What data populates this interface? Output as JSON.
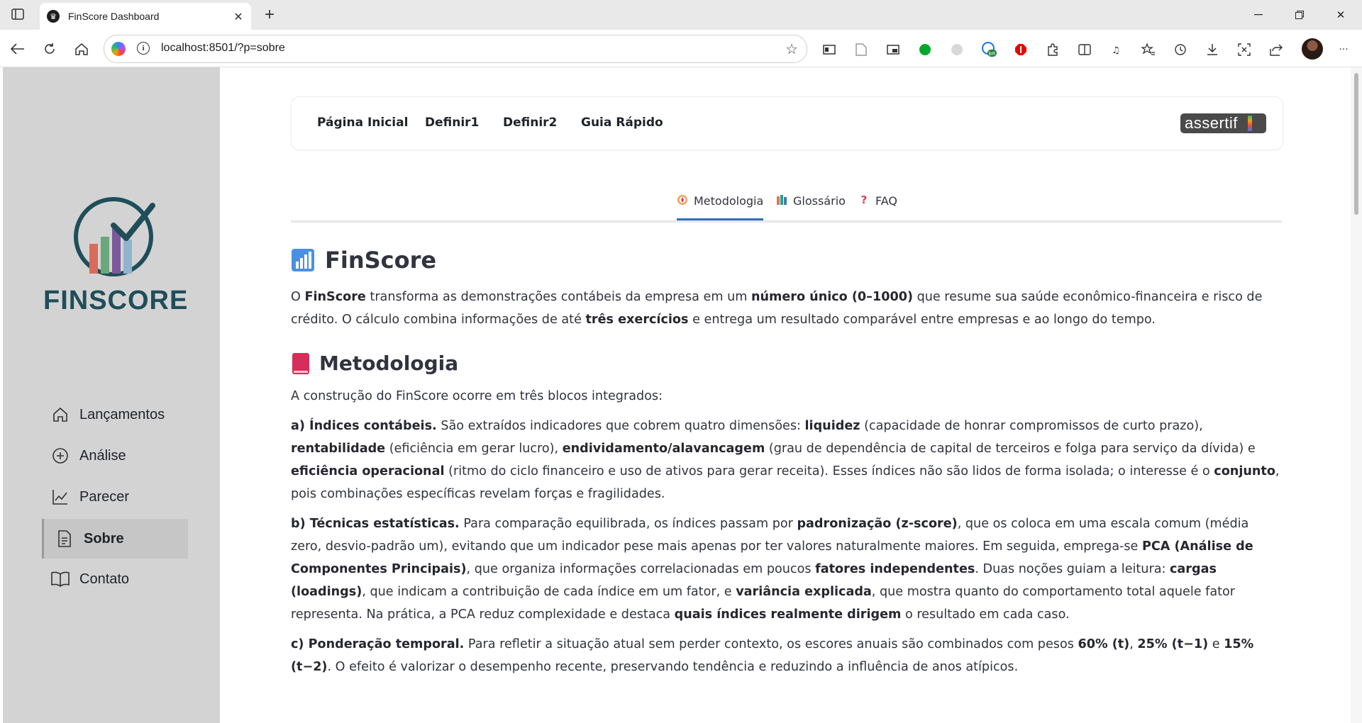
{
  "browser": {
    "tab_title": "FinScore Dashboard",
    "url": "localhost:8501/?p=sobre",
    "ext_badge": "BR"
  },
  "sidebar": {
    "logo_text": "FINSCORE",
    "items": [
      {
        "label": "Lançamentos",
        "icon": "house-icon"
      },
      {
        "label": "Análise",
        "icon": "plus-circle-icon"
      },
      {
        "label": "Parecer",
        "icon": "chart-line-icon"
      },
      {
        "label": "Sobre",
        "icon": "document-icon",
        "active": true
      },
      {
        "label": "Contato",
        "icon": "book-icon"
      }
    ]
  },
  "topnav": {
    "links": [
      "Página Inicial",
      "Definir1",
      "Definir2",
      "Guia Rápido"
    ],
    "brand": "assertif"
  },
  "tabs": [
    {
      "label": "Metodologia",
      "icon": "compass-icon",
      "active": true
    },
    {
      "label": "Glossário",
      "icon": "books-icon"
    },
    {
      "label": "FAQ",
      "icon": "question-icon"
    }
  ],
  "content": {
    "title": "FinScore",
    "intro": [
      {
        "t": "O "
      },
      {
        "b": "FinScore"
      },
      {
        "t": " transforma as demonstrações contábeis da empresa em um "
      },
      {
        "b": "número único (0–1000)"
      },
      {
        "t": " que resume sua saúde econômico-financeira e risco de crédito. O cálculo combina informações de até "
      },
      {
        "b": "três exercícios"
      },
      {
        "t": " e entrega um resultado comparável entre empresas e ao longo do tempo."
      }
    ],
    "section_title": "Metodologia",
    "section_intro": "A construção do FinScore ocorre em três blocos integrados:",
    "block_a": [
      {
        "b": "a) Índices contábeis."
      },
      {
        "t": " São extraídos indicadores que cobrem quatro dimensões: "
      },
      {
        "b": "liquidez"
      },
      {
        "t": " (capacidade de honrar compromissos de curto prazo), "
      },
      {
        "b": "rentabilidade"
      },
      {
        "t": " (eficiência em gerar lucro), "
      },
      {
        "b": "endividamento/alavancagem"
      },
      {
        "t": " (grau de dependência de capital de terceiros e folga para serviço da dívida) e "
      },
      {
        "b": "eficiência operacional"
      },
      {
        "t": " (ritmo do ciclo financeiro e uso de ativos para gerar receita). Esses índices não são lidos de forma isolada; o interesse é o "
      },
      {
        "b": "conjunto"
      },
      {
        "t": ", pois combinações específicas revelam forças e fragilidades."
      }
    ],
    "block_b": [
      {
        "b": "b) Técnicas estatísticas."
      },
      {
        "t": " Para comparação equilibrada, os índices passam por "
      },
      {
        "b": "padronização (z-score)"
      },
      {
        "t": ", que os coloca em uma escala comum (média zero, desvio-padrão um), evitando que um indicador pese mais apenas por ter valores naturalmente maiores. Em seguida, emprega-se "
      },
      {
        "b": "PCA (Análise de Componentes Principais)"
      },
      {
        "t": ", que organiza informações correlacionadas em poucos "
      },
      {
        "b": "fatores independentes"
      },
      {
        "t": ". Duas noções guiam a leitura: "
      },
      {
        "b": "cargas (loadings)"
      },
      {
        "t": ", que indicam a contribuição de cada índice em um fator, e "
      },
      {
        "b": "variância explicada"
      },
      {
        "t": ", que mostra quanto do comportamento total aquele fator representa. Na prática, a PCA reduz complexidade e destaca "
      },
      {
        "b": "quais índices realmente dirigem"
      },
      {
        "t": " o resultado em cada caso."
      }
    ],
    "block_c": [
      {
        "b": "c) Ponderação temporal."
      },
      {
        "t": " Para refletir a situação atual sem perder contexto, os escores anuais são combinados com pesos "
      },
      {
        "b": "60% (t)"
      },
      {
        "t": ", "
      },
      {
        "b": "25% (t−1)"
      },
      {
        "t": " e "
      },
      {
        "b": "15% (t−2)"
      },
      {
        "t": ". O efeito é valorizar o desempenho recente, preservando tendência e reduzindo a influência de anos atípicos."
      }
    ]
  }
}
